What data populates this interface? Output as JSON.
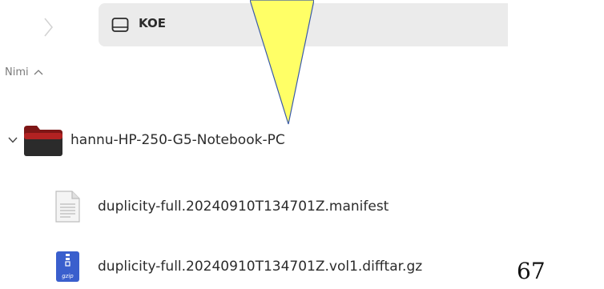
{
  "pathbar": {
    "label": "KOE",
    "icon": "drive-icon"
  },
  "list": {
    "sort_column": "Nimi",
    "sort_direction": "ascending",
    "rows": [
      {
        "name": "hannu-HP-250-G5-Notebook-PC",
        "type": "folder",
        "expanded": true,
        "icon": "folder-icon"
      },
      {
        "name": "duplicity-full.20240910T134701Z.manifest",
        "type": "file",
        "icon": "text-file-icon"
      },
      {
        "name": "duplicity-full.20240910T134701Z.vol1.difftar.gz",
        "type": "file",
        "icon": "gzip-archive-icon"
      }
    ]
  },
  "page_number": "67",
  "colors": {
    "pointer_fill": "#ffff66",
    "folder_red": "#a32020",
    "gzip_blue": "#3a5fcd",
    "pathbar_bg": "#ebebeb"
  }
}
